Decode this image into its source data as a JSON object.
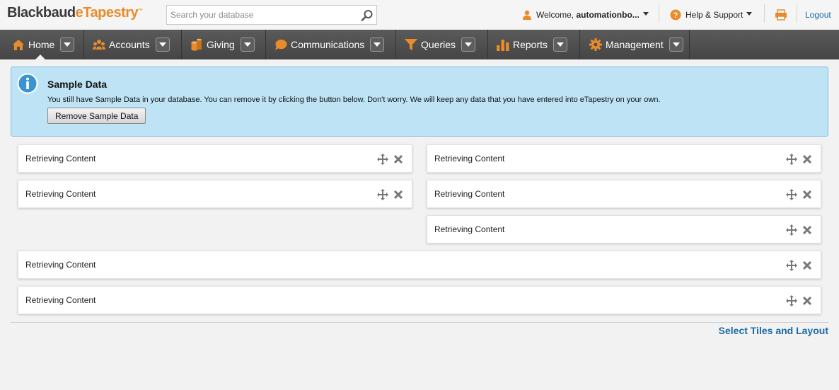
{
  "header": {
    "logo_part1": "Blackbaud",
    "logo_part2": "eTapestry",
    "logo_tm": "™",
    "search_placeholder": "Search your database",
    "welcome_prefix": "Welcome, ",
    "welcome_user": "automationbo...",
    "help_label": "Help & Support",
    "logout_label": "Logout"
  },
  "nav": {
    "items": [
      {
        "label": "Home",
        "icon": "home-icon"
      },
      {
        "label": "Accounts",
        "icon": "accounts-icon"
      },
      {
        "label": "Giving",
        "icon": "giving-icon"
      },
      {
        "label": "Communications",
        "icon": "communications-icon"
      },
      {
        "label": "Queries",
        "icon": "queries-icon"
      },
      {
        "label": "Reports",
        "icon": "reports-icon"
      },
      {
        "label": "Management",
        "icon": "management-icon"
      }
    ],
    "active": "Home"
  },
  "banner": {
    "title": "Sample Data",
    "text": "You still have Sample Data in your database. You can remove it by clicking the button below. Don't worry. We will keep any data that you have entered into eTapestry on your own.",
    "button_label": "Remove Sample Data"
  },
  "tiles": [
    {
      "title": "Retrieving Content"
    },
    {
      "title": "Retrieving Content"
    },
    {
      "title": "Retrieving Content"
    },
    {
      "title": "Retrieving Content"
    },
    {
      "title": "Retrieving Content"
    },
    {
      "title": "Retrieving Content"
    },
    {
      "title": "Retrieving Content"
    }
  ],
  "footer": {
    "select_tiles_label": "Select Tiles and Layout"
  },
  "colors": {
    "accent_orange": "#e98b2b",
    "link_blue": "#1a6aa6",
    "nav_bg": "#4f4f4f",
    "banner_bg": "#bde3f5"
  }
}
